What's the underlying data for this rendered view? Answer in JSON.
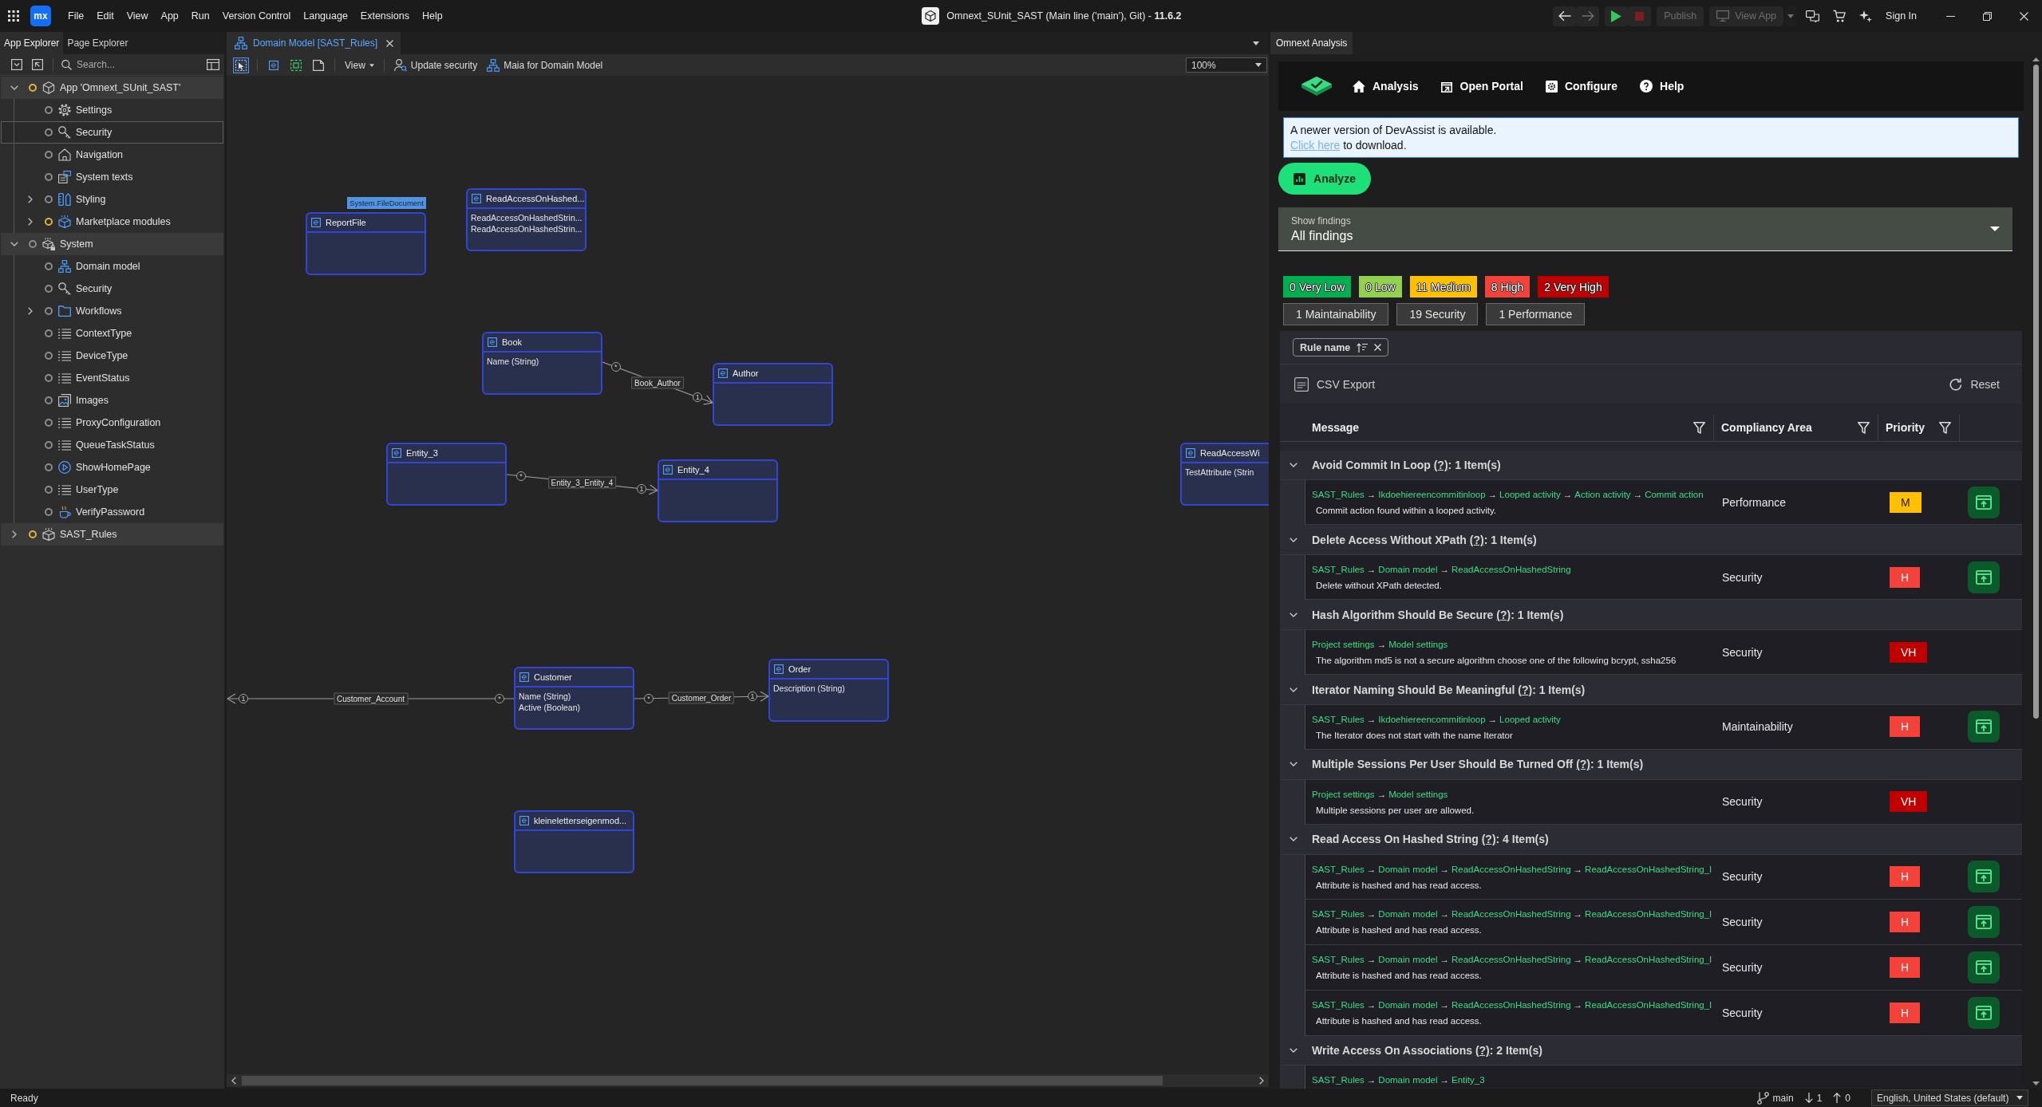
{
  "menu_bar": {
    "logo": "mx",
    "menus": [
      "File",
      "Edit",
      "View",
      "App",
      "Run",
      "Version Control",
      "Language",
      "Extensions",
      "Help"
    ],
    "title": "Omnext_SUnit_SAST (Main line ('main'), Git) - **11.6.2**",
    "toolbar": [
      {
        "kind": "back",
        "disabled": false
      },
      {
        "kind": "forward",
        "disabled": true
      },
      {
        "kind": "run",
        "disabled": false
      },
      {
        "kind": "stop",
        "disabled": true
      },
      {
        "kind": "publish",
        "label": "Publish",
        "disabled": true
      },
      {
        "kind": "view_app",
        "label": "View App",
        "disabled": true
      },
      {
        "kind": "feedback",
        "disabled": false
      },
      {
        "kind": "marketplace",
        "disabled": false
      },
      {
        "kind": "assist",
        "disabled": false
      },
      {
        "kind": "sign_in",
        "label": "Sign In",
        "disabled": false
      }
    ]
  },
  "left_panel": {
    "tabs": [
      {
        "label": "App Explorer",
        "selected": true
      },
      {
        "label": "Page Explorer",
        "selected": false
      }
    ],
    "search": {
      "placeholder": "Search..."
    },
    "tree": [
      {
        "label": "App 'Omnext_SUnit_SAST'",
        "kind": "app",
        "color": "#e0b440",
        "selected": false,
        "expanded": true,
        "children": [
          {
            "label": "Settings",
            "kind": "settings",
            "color": "#8c8c8c",
            "selected": false
          },
          {
            "label": "Security",
            "kind": "security",
            "color": "#8c8c8c",
            "selected": true
          },
          {
            "label": "Navigation",
            "kind": "navigation",
            "color": "#8c8c8c",
            "selected": false
          },
          {
            "label": "System texts",
            "kind": "texts",
            "color": "#8c8c8c",
            "selected": false
          },
          {
            "label": "Styling",
            "kind": "styling",
            "color": "#8c8c8c",
            "selected": false,
            "expanded": false
          },
          {
            "label": "Marketplace modules",
            "kind": "marketplace",
            "color": "#e0b440",
            "selected": false,
            "expanded": false
          }
        ]
      },
      {
        "label": "System",
        "kind": "system_module",
        "color": "#8c8c8c",
        "selected": false,
        "expanded": true,
        "children": [
          {
            "label": "Domain model",
            "kind": "domain",
            "color": "#8c8c8c",
            "selected": false
          },
          {
            "label": "Security",
            "kind": "security",
            "color": "#8c8c8c",
            "selected": false
          },
          {
            "label": "Workflows",
            "kind": "folder",
            "color": "#8c8c8c",
            "selected": false,
            "expanded": false
          },
          {
            "label": "ContextType",
            "kind": "enumeration",
            "color": "#8c8c8c",
            "selected": false
          },
          {
            "label": "DeviceType",
            "kind": "enumeration",
            "color": "#8c8c8c",
            "selected": false
          },
          {
            "label": "EventStatus",
            "kind": "enumeration",
            "color": "#8c8c8c",
            "selected": false
          },
          {
            "label": "Images",
            "kind": "images",
            "color": "#8c8c8c",
            "selected": false
          },
          {
            "label": "ProxyConfiguration",
            "kind": "enumeration",
            "color": "#8c8c8c",
            "selected": false
          },
          {
            "label": "QueueTaskStatus",
            "kind": "enumeration",
            "color": "#8c8c8c",
            "selected": false
          },
          {
            "label": "ShowHomePage",
            "kind": "flow",
            "color": "#8c8c8c",
            "selected": false
          },
          {
            "label": "UserType",
            "kind": "enumeration",
            "color": "#8c8c8c",
            "selected": false
          },
          {
            "label": "VerifyPassword",
            "kind": "java",
            "color": "#8c8c8c",
            "selected": false
          }
        ]
      },
      {
        "label": "SAST_Rules",
        "kind": "module",
        "color": "#e0b440",
        "selected": false,
        "expanded": false
      }
    ]
  },
  "editor": {
    "tabs": [
      {
        "label": "Domain Model [SAST_Rules]",
        "selected": true
      }
    ],
    "tools": [
      {
        "kind": "select",
        "selected": true
      },
      {
        "kind": "entity",
        "selected": false
      },
      {
        "kind": "dashed",
        "selected": false
      },
      {
        "kind": "note",
        "selected": false
      }
    ],
    "view_menu": "View",
    "actions": [
      {
        "kind": "security",
        "label": "Update security"
      },
      {
        "kind": "assistant",
        "label": "Maia for Domain Model"
      }
    ],
    "zoom": "100%",
    "entities": [
      {
        "name": "ReportFile",
        "generalization": "System.FileDocument"
      },
      {
        "name": "ReadAccessOnHashed...",
        "attributes": [
          "ReadAccessOnHashedStrin...",
          "ReadAccessOnHashedStrin..."
        ]
      },
      {
        "name": "Book",
        "attributes": [
          "Name (String)"
        ]
      },
      {
        "name": "Author"
      },
      {
        "name": "Entity_3"
      },
      {
        "name": "Entity_4"
      },
      {
        "name": "ReadAccessWi",
        "attributes": [
          "TestAttribute (Strin"
        ]
      },
      {
        "name": "Customer",
        "attributes": [
          "Name (String)",
          "Active (Boolean)"
        ]
      },
      {
        "name": "Order",
        "attributes": [
          "Description (String)"
        ]
      },
      {
        "name": "kleineletterseigenmod..."
      }
    ],
    "associations": [
      {
        "name": "Book_Author",
        "source_multiplicity": "*",
        "target_multiplicity": "1"
      },
      {
        "name": "Entity_3_Entity_4",
        "source_multiplicity": "*",
        "target_multiplicity": "1"
      },
      {
        "name": "Customer_Account",
        "source_multiplicity": "*",
        "target_multiplicity": "1"
      },
      {
        "name": "Customer_Order",
        "source_multiplicity": "*",
        "target_multiplicity": "1"
      }
    ]
  },
  "analysis_panel": {
    "tabs": [
      {
        "label": "Omnext Analysis",
        "selected": true
      }
    ],
    "nav": [
      {
        "kind": "home",
        "label": "Analysis"
      },
      {
        "kind": "portal",
        "label": "Open Portal"
      },
      {
        "kind": "configure",
        "label": "Configure"
      },
      {
        "kind": "help",
        "label": "Help"
      }
    ],
    "notice": {
      "message": "A newer version of DevAssist is available.",
      "link": "Click here",
      "link_suffix": "to download."
    },
    "analyze_button": "Analyze",
    "findings_select": {
      "label": "Show findings",
      "value": "All findings"
    },
    "severity_counts": [
      {
        "label": "0 Very Low",
        "color": "#00b050"
      },
      {
        "label": "0 Low",
        "color": "#92d050"
      },
      {
        "label": "11 Medium",
        "color": "#ffc000"
      },
      {
        "label": "8 High",
        "color": "#f4413a"
      },
      {
        "label": "2 Very High",
        "color": "#c00000"
      }
    ],
    "area_counts": [
      "1 Maintainability",
      "19 Security",
      "1 Performance"
    ],
    "sort_chip": "Rule name",
    "csv_export": "CSV Export",
    "reset": "Reset",
    "columns": [
      "Message",
      "Compliancy Area",
      "Priority"
    ],
    "groups": [
      {
        "title": "Avoid Commit In Loop",
        "help": "(?)",
        "count": ": 1 Item(s)",
        "expanded": true,
        "items": [
          {
            "path": [
              "SAST_Rules",
              "→",
              "Ikdoehiereencommitinloop",
              "→",
              "Looped activity",
              "→",
              "Action activity",
              "→",
              "Commit action"
            ],
            "message": "Commit action found within a looped activity.",
            "area": "Performance",
            "priority": "M",
            "color": "#ffc000",
            "action_button": true
          }
        ]
      },
      {
        "title": "Delete Access Without XPath",
        "help": "(?)",
        "count": ": 1 Item(s)",
        "expanded": true,
        "items": [
          {
            "path": [
              "SAST_Rules",
              "→",
              "Domain model",
              "→",
              "ReadAccessOnHashedString"
            ],
            "message": "Delete without XPath detected.",
            "area": "Security",
            "priority": "H",
            "color": "#f4413a",
            "action_button": true
          }
        ]
      },
      {
        "title": "Hash Algorithm Should Be Secure",
        "help": "(?)",
        "count": ": 1 Item(s)",
        "expanded": true,
        "items": [
          {
            "path": [
              "Project settings",
              "→",
              "Model settings"
            ],
            "message": "The algorithm md5 is not a secure algorithm choose one of the following bcrypt, ssha256",
            "area": "Security",
            "priority": "VH",
            "color": "#c00000",
            "action_button": false
          }
        ]
      },
      {
        "title": "Iterator Naming Should Be Meaningful",
        "help": "(?)",
        "count": ": 1 Item(s)",
        "expanded": true,
        "items": [
          {
            "path": [
              "SAST_Rules",
              "→",
              "Ikdoehiereencommitinloop",
              "→",
              "Looped activity"
            ],
            "message": "The Iterator does not start with the name Iterator",
            "area": "Maintainability",
            "priority": "H",
            "color": "#f4413a",
            "action_button": true
          }
        ]
      },
      {
        "title": "Multiple Sessions Per User Should Be Turned Off",
        "help": "(?)",
        "count": ": 1 Item(s)",
        "expanded": true,
        "items": [
          {
            "path": [
              "Project settings",
              "→",
              "Model settings"
            ],
            "message": "Multiple sessions per user are allowed.",
            "area": "Security",
            "priority": "VH",
            "color": "#c00000",
            "action_button": false
          }
        ]
      },
      {
        "title": "Read Access On Hashed String",
        "help": "(?)",
        "count": ": 4 Item(s)",
        "expanded": true,
        "items": [
          {
            "path": [
              "SAST_Rules",
              "→",
              "Domain model",
              "→",
              "ReadAccessOnHashedString",
              "→",
              "ReadAccessOnHashedString_I"
            ],
            "message": "Attribute is hashed and has read access.",
            "area": "Security",
            "priority": "H",
            "color": "#f4413a",
            "action_button": true
          },
          {
            "path": [
              "SAST_Rules",
              "→",
              "Domain model",
              "→",
              "ReadAccessOnHashedString",
              "→",
              "ReadAccessOnHashedString_I"
            ],
            "message": "Attribute is hashed and has read access.",
            "area": "Security",
            "priority": "H",
            "color": "#f4413a",
            "action_button": true
          },
          {
            "path": [
              "SAST_Rules",
              "→",
              "Domain model",
              "→",
              "ReadAccessOnHashedString",
              "→",
              "ReadAccessOnHashedString_I"
            ],
            "message": "Attribute is hashed and has read access.",
            "area": "Security",
            "priority": "H",
            "color": "#f4413a",
            "action_button": true
          },
          {
            "path": [
              "SAST_Rules",
              "→",
              "Domain model",
              "→",
              "ReadAccessOnHashedString",
              "→",
              "ReadAccessOnHashedString_I"
            ],
            "message": "Attribute is hashed and has read access.",
            "area": "Security",
            "priority": "H",
            "color": "#f4413a",
            "action_button": true
          }
        ]
      },
      {
        "title": "Write Access On Associations",
        "help": "(?)",
        "count": ": 2 Item(s)",
        "expanded": true,
        "items": [
          {
            "path": [
              "SAST_Rules",
              "→",
              "Domain model",
              "→",
              "Entity_3"
            ],
            "action_button": false
          }
        ]
      }
    ]
  },
  "status_bar": {
    "text": "Ready",
    "branch": "main",
    "incoming": "1",
    "outgoing": "0",
    "language": "English, United States (default)"
  }
}
